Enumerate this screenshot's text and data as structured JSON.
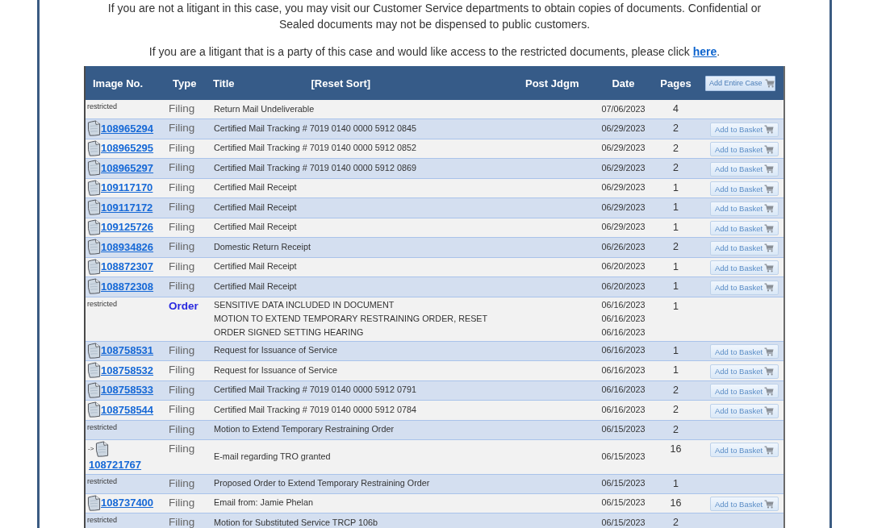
{
  "notice": {
    "text": "If you are not a litigant in this case, you may visit our Customer Service departments to obtain copies of documents. Confidential or Sealed documents may not be dispensed to public customers."
  },
  "access_note": {
    "text": "If you are a litigant that is a party of this case and would like access to the restricted documents, please click",
    "link": "here",
    "suffix": "."
  },
  "table": {
    "columns": [
      {
        "label": "Image No."
      },
      {
        "label": "Type"
      },
      {
        "label": "Title",
        "reset_link": "[Reset Sort]"
      },
      {
        "label": "Post Jdgm"
      },
      {
        "label": "Date"
      },
      {
        "label": "Pages"
      }
    ],
    "add_entire_case_button": "Add Entire Case",
    "rows": [
      {
        "image": {
          "kind": "restricted",
          "text": "restricted"
        },
        "type": {
          "text": "Filing",
          "emphasized": false
        },
        "titles": [
          "Return Mail Undeliverable"
        ],
        "dates": [
          "07/06/2023"
        ],
        "pages": "4"
      },
      {
        "image": {
          "kind": "document",
          "number": "108965294"
        },
        "type": {
          "text": "Filing",
          "emphasized": false
        },
        "titles": [
          "Certified Mail Tracking # 7019 0140 0000 5912 0845"
        ],
        "dates": [
          "06/29/2023"
        ],
        "pages": "2",
        "button": "Add to Basket"
      },
      {
        "image": {
          "kind": "document",
          "number": "108965295"
        },
        "type": {
          "text": "Filing",
          "emphasized": false
        },
        "titles": [
          "Certified Mail Tracking # 7019 0140 0000 5912 0852"
        ],
        "dates": [
          "06/29/2023"
        ],
        "pages": "2",
        "button": "Add to Basket"
      },
      {
        "image": {
          "kind": "document",
          "number": "108965297"
        },
        "type": {
          "text": "Filing",
          "emphasized": false
        },
        "titles": [
          "Certified Mail Tracking # 7019 0140 0000 5912 0869"
        ],
        "dates": [
          "06/29/2023"
        ],
        "pages": "2",
        "button": "Add to Basket"
      },
      {
        "image": {
          "kind": "document",
          "number": "109117170"
        },
        "type": {
          "text": "Filing",
          "emphasized": false
        },
        "titles": [
          "Certified Mail Receipt"
        ],
        "dates": [
          "06/29/2023"
        ],
        "pages": "1",
        "button": "Add to Basket"
      },
      {
        "image": {
          "kind": "document",
          "number": "109117172"
        },
        "type": {
          "text": "Filing",
          "emphasized": false
        },
        "titles": [
          "Certified Mail Receipt"
        ],
        "dates": [
          "06/29/2023"
        ],
        "pages": "1",
        "button": "Add to Basket"
      },
      {
        "image": {
          "kind": "document",
          "number": "109125726"
        },
        "type": {
          "text": "Filing",
          "emphasized": false
        },
        "titles": [
          "Certified Mail Receipt"
        ],
        "dates": [
          "06/29/2023"
        ],
        "pages": "1",
        "button": "Add to Basket"
      },
      {
        "image": {
          "kind": "document",
          "number": "108934826"
        },
        "type": {
          "text": "Filing",
          "emphasized": false
        },
        "titles": [
          "Domestic Return Receipt"
        ],
        "dates": [
          "06/26/2023"
        ],
        "pages": "2",
        "button": "Add to Basket"
      },
      {
        "image": {
          "kind": "document",
          "number": "108872307"
        },
        "type": {
          "text": "Filing",
          "emphasized": false
        },
        "titles": [
          "Certified Mail Receipt"
        ],
        "dates": [
          "06/20/2023"
        ],
        "pages": "1",
        "button": "Add to Basket"
      },
      {
        "image": {
          "kind": "document",
          "number": "108872308"
        },
        "type": {
          "text": "Filing",
          "emphasized": false
        },
        "titles": [
          "Certified Mail Receipt"
        ],
        "dates": [
          "06/20/2023"
        ],
        "pages": "1",
        "button": "Add to Basket"
      },
      {
        "image": {
          "kind": "restricted",
          "text": "restricted"
        },
        "type": {
          "text": "Order",
          "emphasized": true
        },
        "titles": [
          "SENSITIVE DATA INCLUDED IN DOCUMENT",
          "MOTION TO EXTEND TEMPORARY RESTRAINING ORDER, RESET",
          "ORDER SIGNED SETTING HEARING"
        ],
        "dates": [
          "06/16/2023",
          "06/16/2023",
          "06/16/2023"
        ],
        "pages": "1"
      },
      {
        "image": {
          "kind": "document",
          "number": "108758531"
        },
        "type": {
          "text": "Filing",
          "emphasized": false
        },
        "titles": [
          "Request for Issuance of Service"
        ],
        "dates": [
          "06/16/2023"
        ],
        "pages": "1",
        "button": "Add to Basket"
      },
      {
        "image": {
          "kind": "document",
          "number": "108758532"
        },
        "type": {
          "text": "Filing",
          "emphasized": false
        },
        "titles": [
          "Request for Issuance of Service"
        ],
        "dates": [
          "06/16/2023"
        ],
        "pages": "1",
        "button": "Add to Basket"
      },
      {
        "image": {
          "kind": "document",
          "number": "108758533"
        },
        "type": {
          "text": "Filing",
          "emphasized": false
        },
        "titles": [
          "Certified Mail Tracking # 7019 0140 0000 5912 0791"
        ],
        "dates": [
          "06/16/2023"
        ],
        "pages": "2",
        "button": "Add to Basket"
      },
      {
        "image": {
          "kind": "document",
          "number": "108758544"
        },
        "type": {
          "text": "Filing",
          "emphasized": false
        },
        "titles": [
          "Certified Mail Tracking # 7019 0140 0000 5912 0784"
        ],
        "dates": [
          "06/16/2023"
        ],
        "pages": "2",
        "button": "Add to Basket"
      },
      {
        "image": {
          "kind": "restricted",
          "text": "restricted"
        },
        "type": {
          "text": "Filing",
          "emphasized": false
        },
        "titles": [
          "Motion to Extend Temporary Restraining Order"
        ],
        "dates": [
          "06/15/2023"
        ],
        "pages": "2"
      },
      {
        "image": {
          "kind": "linked_document",
          "prefix": "->",
          "number": "108721767"
        },
        "type": {
          "text": "Filing",
          "emphasized": false
        },
        "titles": [
          "E-mail regarding TRO granted"
        ],
        "dates": [
          "06/15/2023"
        ],
        "pages": "16",
        "button": "Add to Basket"
      },
      {
        "image": {
          "kind": "restricted",
          "text": "restricted"
        },
        "type": {
          "text": "Filing",
          "emphasized": false
        },
        "titles": [
          "Proposed Order to Extend Temporary Restraining Order"
        ],
        "dates": [
          "06/15/2023"
        ],
        "pages": "1"
      },
      {
        "image": {
          "kind": "document",
          "number": "108737400"
        },
        "type": {
          "text": "Filing",
          "emphasized": false
        },
        "titles": [
          "Email from: Jamie Phelan"
        ],
        "dates": [
          "06/15/2023"
        ],
        "pages": "16",
        "button": "Add to Basket"
      },
      {
        "image": {
          "kind": "restricted",
          "text": "restricted"
        },
        "type": {
          "text": "Filing",
          "emphasized": false
        },
        "titles": [
          "Motion for Substituted Service TRCP 106b"
        ],
        "dates": [
          "06/15/2023"
        ],
        "pages": "2"
      }
    ]
  }
}
